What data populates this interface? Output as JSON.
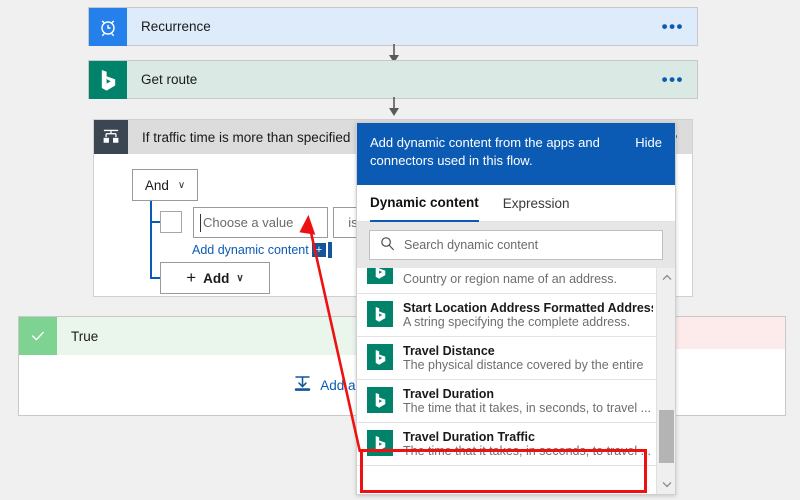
{
  "flow": {
    "steps": [
      {
        "title": "Recurrence",
        "icon": "alarm-clock-icon",
        "menu": "•••"
      },
      {
        "title": "Get route",
        "icon": "bing-maps-icon",
        "menu": "•••"
      }
    ],
    "condition": {
      "title": "If traffic time is more than specified",
      "icon": "condition-branch-icon",
      "menu": "•••",
      "operator_label": "And",
      "operator_chevron": "∨",
      "row": {
        "value_placeholder": "Choose a value",
        "operator": "is"
      },
      "add_dynamic_content_link": "Add dynamic content",
      "plus_chip": "+",
      "add_button_label": "Add",
      "add_button_plus": "+",
      "add_button_chevron": "∨"
    },
    "branches": {
      "true": {
        "label": "True",
        "icon": "check-icon",
        "add_action_label": "Add an action",
        "add_action_icon": "insert-action-icon"
      },
      "false": {
        "label": "",
        "icon": "x-icon"
      }
    }
  },
  "dynamic_content_panel": {
    "header_text": "Add dynamic content from the apps and connectors used in this flow.",
    "hide_label": "Hide",
    "tabs": [
      {
        "label": "Dynamic content",
        "active": true
      },
      {
        "label": "Expression",
        "active": false
      }
    ],
    "search": {
      "placeholder": "Search dynamic content",
      "value": "",
      "icon": "search-icon"
    },
    "scrollbar": {
      "up_icon": "chevron-up-icon",
      "down_icon": "chevron-down-icon"
    },
    "items": [
      {
        "title": "",
        "description": "Country or region name of an address.",
        "icon": "bing-maps-icon",
        "partial": true,
        "highlighted": false
      },
      {
        "title": "Start Location Address Formatted Address",
        "description": "A string specifying the complete address.",
        "icon": "bing-maps-icon",
        "partial": false,
        "highlighted": false
      },
      {
        "title": "Travel Distance",
        "description": "The physical distance covered by the entire",
        "icon": "bing-maps-icon",
        "partial": false,
        "highlighted": false
      },
      {
        "title": "Travel Duration",
        "description": "The time that it takes, in seconds, to travel ...",
        "icon": "bing-maps-icon",
        "partial": false,
        "highlighted": false
      },
      {
        "title": "Travel Duration Traffic",
        "description": "The time that it takes, in seconds, to travel ...",
        "icon": "bing-maps-icon",
        "partial": false,
        "highlighted": true
      }
    ]
  },
  "annotation": {
    "highlight_color": "#ee1111",
    "arrow_name": "red-callout-arrow"
  },
  "colors": {
    "canvas": "#f0f0f0",
    "trigger_card": "#deebfb",
    "trigger_icon": "#2680eb",
    "action_card": "#dbe9e5",
    "bing_green": "#00836a",
    "condition_header": "#dcdcdc",
    "condition_icon": "#3b4652",
    "true_header": "#eaf6ec",
    "true_icon": "#7ed392",
    "false_header": "#fdeaea",
    "accent_blue": "#0b5bb5"
  }
}
